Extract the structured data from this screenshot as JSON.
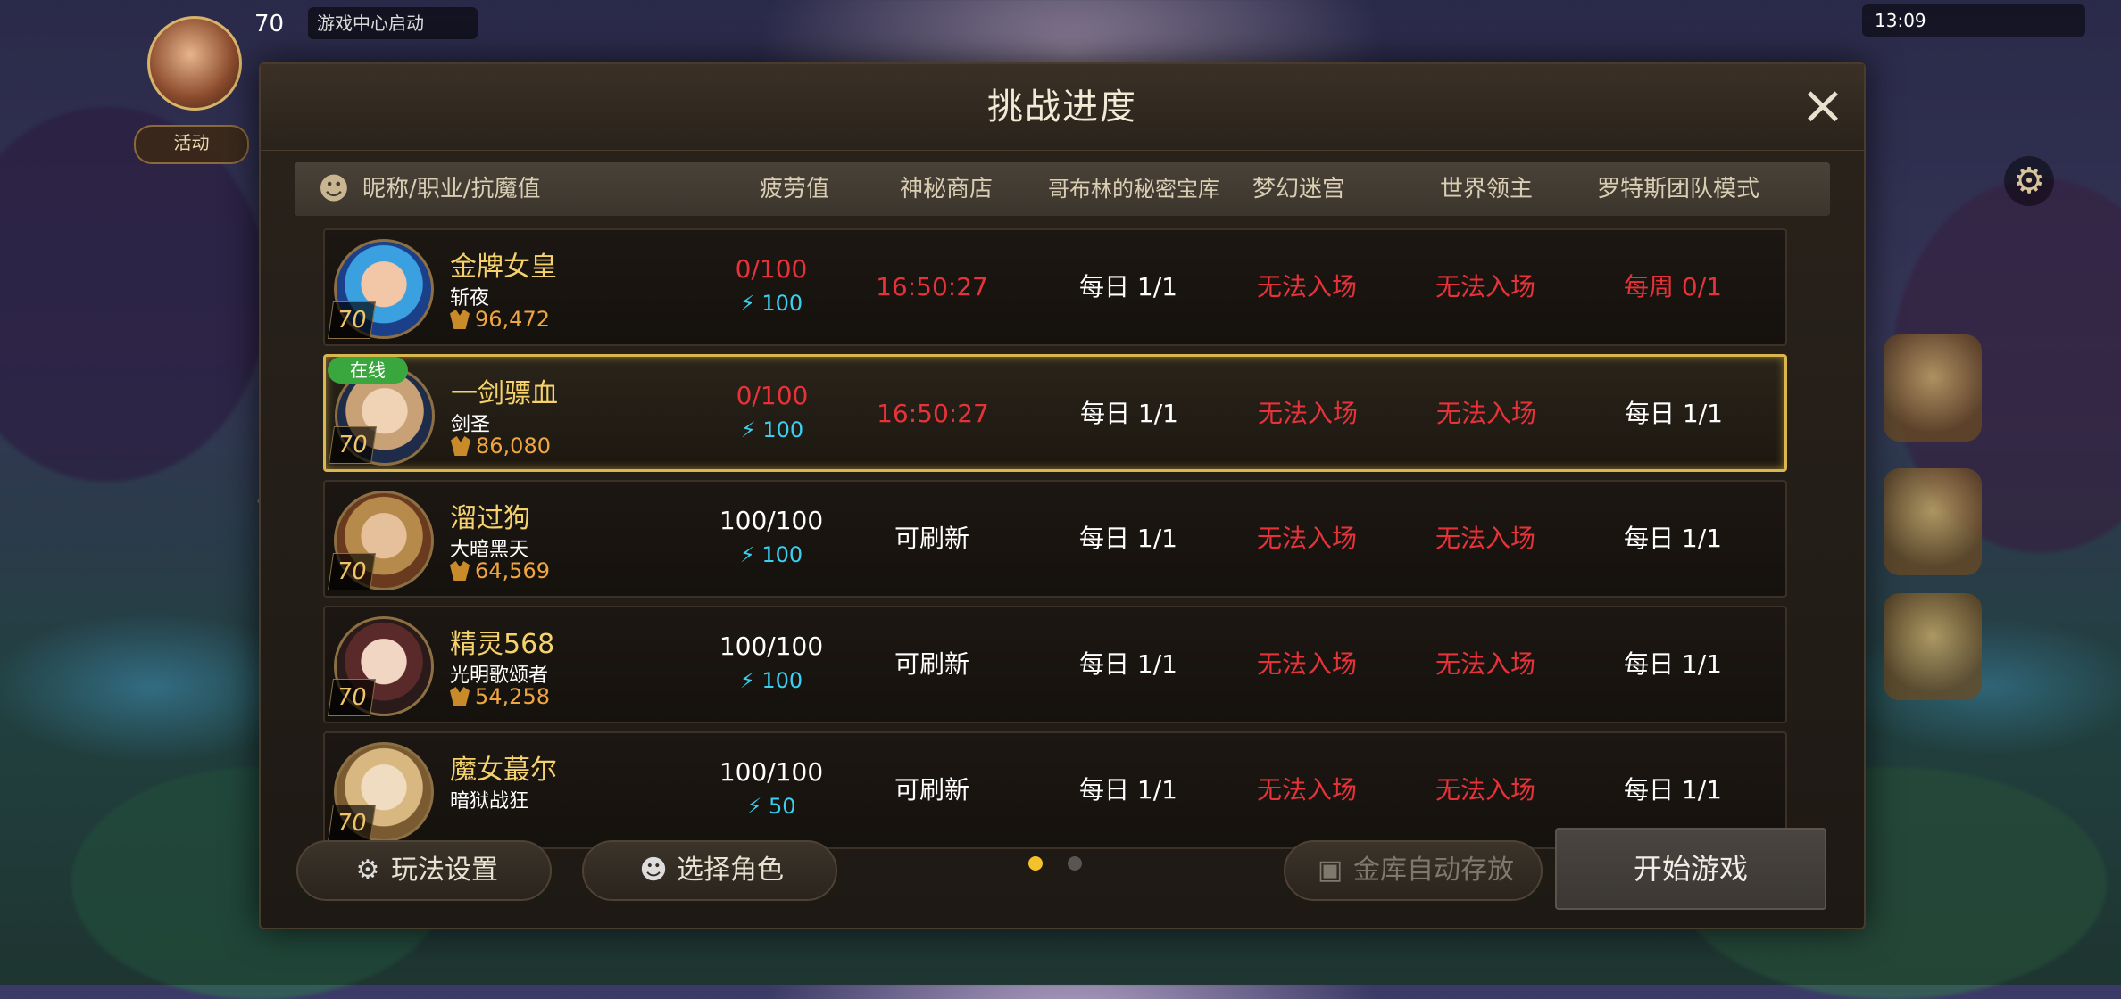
{
  "hud": {
    "level": "70",
    "game_center": "游戏中心启动",
    "small_btn": "活动",
    "status": "13:09"
  },
  "modal": {
    "title": "挑战进度",
    "close_icon": "close-icon"
  },
  "columns": {
    "name": "昵称/职业/抗魔值",
    "fatigue": "疲劳值",
    "shop": "神秘商店",
    "goblin": "哥布林的秘密宝库",
    "maze": "梦幻迷宫",
    "lord": "世界领主",
    "rotes": "罗特斯团队模式"
  },
  "rows": [
    {
      "nick": "金牌女皇",
      "job": "斩夜",
      "power": "96,472",
      "level": "70",
      "online": "",
      "fatigue": "0/100",
      "fatigue_red": true,
      "energy": "100",
      "shop": "16:50:27",
      "shop_red": true,
      "goblin": "每日 1/1",
      "maze": "无法入场",
      "lord": "无法入场",
      "rotes": "每周 0/1",
      "rotes_red": true,
      "portrait_colors": [
        "#1c3f8a",
        "#3aa0e0",
        "#f1c7a8"
      ]
    },
    {
      "nick": "一剑骠血",
      "job": "剑圣",
      "power": "86,080",
      "level": "70",
      "online": "在线",
      "fatigue": "0/100",
      "fatigue_red": true,
      "energy": "100",
      "shop": "16:50:27",
      "shop_red": true,
      "goblin": "每日 1/1",
      "maze": "无法入场",
      "lord": "无法入场",
      "rotes": "每日 1/1",
      "rotes_red": false,
      "portrait_colors": [
        "#1e2c4a",
        "#c8a276",
        "#f0d2b4"
      ]
    },
    {
      "nick": "溜过狗",
      "job": "大暗黑天",
      "power": "64,569",
      "level": "70",
      "online": "",
      "fatigue": "100/100",
      "fatigue_red": false,
      "energy": "100",
      "shop": "可刷新",
      "shop_red": false,
      "goblin": "每日 1/1",
      "maze": "无法入场",
      "lord": "无法入场",
      "rotes": "每日 1/1",
      "rotes_red": false,
      "portrait_colors": [
        "#6a3a1e",
        "#b58a4a",
        "#e6c09a"
      ]
    },
    {
      "nick": "精灵568",
      "job": "光明歌颂者",
      "power": "54,258",
      "level": "70",
      "online": "",
      "fatigue": "100/100",
      "fatigue_red": false,
      "energy": "100",
      "shop": "可刷新",
      "shop_red": false,
      "goblin": "每日 1/1",
      "maze": "无法入场",
      "lord": "无法入场",
      "rotes": "每日 1/1",
      "rotes_red": false,
      "portrait_colors": [
        "#2a1a1a",
        "#5a2a2a",
        "#f2d6c4"
      ]
    },
    {
      "nick": "魔女蕞尔",
      "job": "暗狱战狂",
      "power": "",
      "level": "70",
      "online": "",
      "fatigue": "100/100",
      "fatigue_red": false,
      "energy": "50",
      "shop": "可刷新",
      "shop_red": false,
      "goblin": "每日 1/1",
      "maze": "无法入场",
      "lord": "无法入场",
      "rotes": "每日 1/1",
      "rotes_red": false,
      "portrait_colors": [
        "#7a5a30",
        "#d8b880",
        "#f0dcc0"
      ]
    }
  ],
  "footer": {
    "settings": "玩法设置",
    "select_role": "选择角色",
    "auto_store": "金库自动存放",
    "start": "开始游戏",
    "page": 1,
    "pages": 2
  },
  "colors": {
    "accent_gold": "#d9b64e",
    "red": "#e8323a",
    "energy_cyan": "#3ad0f2",
    "online_green": "#3aa63e"
  }
}
